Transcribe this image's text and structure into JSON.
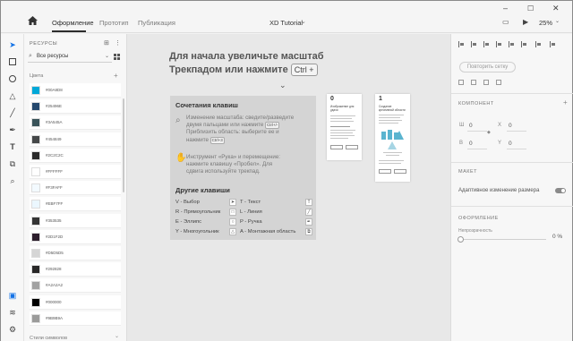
{
  "titlebar": {
    "tabs": [
      {
        "label": "Оформление",
        "active": true
      },
      {
        "label": "Прототип",
        "active": false
      },
      {
        "label": "Публикация",
        "active": false
      }
    ],
    "document_title": "XD Tutorial",
    "zoom": "25%",
    "window_controls": [
      "minimize-icon",
      "maximize-icon",
      "close-icon"
    ]
  },
  "tools": [
    "select-icon",
    "rectangle-icon",
    "ellipse-icon",
    "triangle-icon",
    "line-icon",
    "pen-icon",
    "text-icon",
    "artboard-icon",
    "zoom-icon"
  ],
  "assets": {
    "title": "РЕСУРСЫ",
    "search_value": "Все ресурсы",
    "colors_heading": "Цвета",
    "styles_heading": "Стили символов",
    "colors": [
      {
        "label": "#00A8D8",
        "hex": "#00A8D8"
      },
      {
        "label": "#25496E",
        "hex": "#25496E"
      },
      {
        "label": "#3A545A",
        "hex": "#3A545A"
      },
      {
        "label": "#454849",
        "hex": "#454849"
      },
      {
        "label": "#2C2C2C",
        "hex": "#2C2C2C"
      },
      {
        "label": "#FFFFFF",
        "hex": "#FFFFFF"
      },
      {
        "label": "#F3FAFF",
        "hex": "#F3FAFF"
      },
      {
        "label": "#EBF7FF",
        "hex": "#EBF7FF"
      },
      {
        "label": "#353535",
        "hex": "#353535"
      },
      {
        "label": "#2D1F2D",
        "hex": "#2D1F2D"
      },
      {
        "label": "#D5D5D5",
        "hex": "#D5D5D5"
      },
      {
        "label": "#292828",
        "hex": "#292828"
      },
      {
        "label": "#A2A2A2",
        "hex": "#A2A2A2"
      },
      {
        "label": "#000000",
        "hex": "#000000"
      },
      {
        "label": "#9B9B9A",
        "hex": "#9B9B9A"
      }
    ]
  },
  "canvas": {
    "hint_line1": "Для начала увеличьте масштаб",
    "hint_line2": "Трекпадом или нажмите",
    "hint_key": "Ctrl +",
    "tips_title": "Сочетания клавиш",
    "tip1_lines": [
      "Изменение масштаба: сведите/разведите",
      "двумя пальцами или нажмите",
      "Приблизить область: выберите ее и",
      "нажмите"
    ],
    "tip1_key_a": "Ctrl+/-",
    "tip1_key_b": "Ctrl+3",
    "tip2_lines": [
      "Инструмент «Рука» и перемещение:",
      "нажмите клавишу «Пробел». Для",
      "сдвига используйте трекпад."
    ],
    "other_title": "Другие клавиши",
    "shortcuts_left": [
      "V - Выбор",
      "R - Прямоугольник",
      "E - Эллипс",
      "Y - Многоугольник"
    ],
    "shortcuts_right": [
      "T - Текст",
      "L - Линия",
      "P - Ручка",
      "A - Монтажная область"
    ],
    "artboard1": {
      "number": "0",
      "title": "Изображение для удачи"
    },
    "artboard2": {
      "number": "1",
      "title": "Создание креативной области"
    }
  },
  "props": {
    "repeat_grid": "Повторить сетку",
    "component_heading": "КОМПОНЕНТ",
    "w_label": "Ш",
    "w_value": "0",
    "x_label": "X",
    "x_value": "0",
    "h_label": "В",
    "h_value": "0",
    "y_label": "Y",
    "y_value": "0",
    "layout_heading": "МАКЕТ",
    "responsive_label": "Адаптивное изменение размера",
    "responsive_on": true,
    "appearance_heading": "ОФОРМЛЕНИЕ",
    "opacity_label": "Непрозрачность",
    "opacity_value": "0 %",
    "opacity_fraction": 0.0
  }
}
